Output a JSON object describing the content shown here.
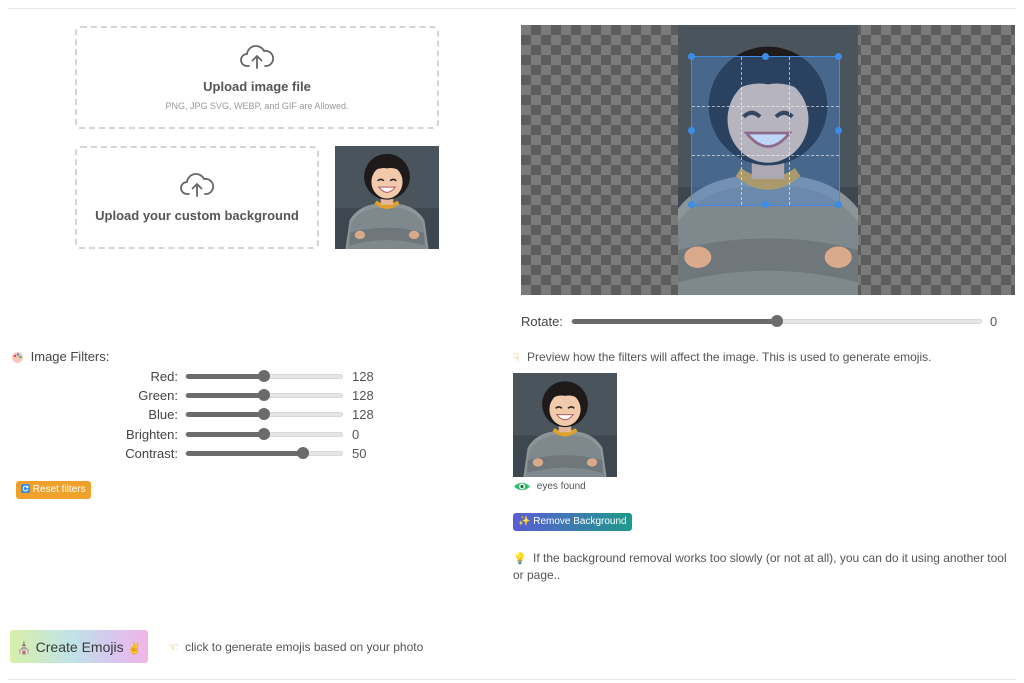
{
  "upload_image": {
    "title": "Upload image file",
    "subtitle": "PNG, JPG SVG, WEBP, and GIF are Allowed.",
    "icon": "cloud-upload-icon"
  },
  "upload_background": {
    "title": "Upload your custom background",
    "icon": "cloud-upload-icon"
  },
  "rotate": {
    "label": "Rotate:",
    "value": "0",
    "fraction": 0.5
  },
  "filters": {
    "title": "Image Filters:",
    "items": [
      {
        "label": "Red:",
        "value": "128",
        "fraction": 0.5
      },
      {
        "label": "Green:",
        "value": "128",
        "fraction": 0.5
      },
      {
        "label": "Blue:",
        "value": "128",
        "fraction": 0.5
      },
      {
        "label": "Brighten:",
        "value": "0",
        "fraction": 0.5
      },
      {
        "label": "Contrast:",
        "value": "50",
        "fraction": 0.75
      }
    ],
    "reset_label": "Reset filters"
  },
  "preview": {
    "hint": "Preview how the filters will affect the image. This is used to generate emojis.",
    "eyes_status": "eyes found",
    "remove_bg_label": "Remove Background",
    "slow_note": "If the background removal works too slowly (or not at all), you can do it using another tool or page.."
  },
  "create": {
    "button_label": "Create Emojis",
    "hint": "click to generate emojis based on your photo"
  },
  "colors": {
    "reset_button": "#f0a12a",
    "remove_bg_gradient_start": "#5b5cd6",
    "remove_bg_gradient_end": "#1d9a8a",
    "crop_border": "#3d8ce6",
    "eye_icon": "#2bbf6a"
  }
}
